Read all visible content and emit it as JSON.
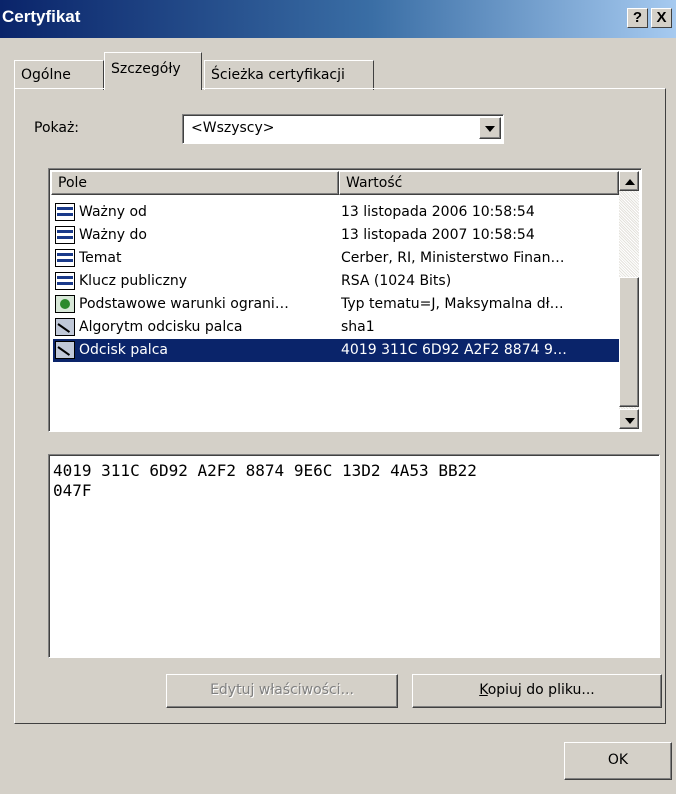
{
  "window": {
    "title": "Certyfikat",
    "help_label": "?",
    "close_label": "X"
  },
  "tabs": [
    {
      "label": "Ogólne",
      "active": false
    },
    {
      "label": "Szczegóły",
      "active": true
    },
    {
      "label": "Ścieżka certyfikacji",
      "active": false
    }
  ],
  "show": {
    "label": "Pokaż:",
    "selected": "<Wszyscy>"
  },
  "list": {
    "columns": [
      "Pole",
      "Wartość"
    ],
    "rows": [
      {
        "field": "Ważny od",
        "value": "13 listopada 2006 10:58:54",
        "icon": "certificate-field-icon"
      },
      {
        "field": "Ważny do",
        "value": "13 listopada 2007 10:58:54",
        "icon": "certificate-field-icon"
      },
      {
        "field": "Temat",
        "value": "Cerber, RI, Ministerstwo Finan…",
        "icon": "certificate-field-icon"
      },
      {
        "field": "Klucz publiczny",
        "value": "RSA (1024 Bits)",
        "icon": "certificate-field-icon"
      },
      {
        "field": "Podstawowe warunki ograni…",
        "value": "Typ tematu=J, Maksymalna dł…",
        "icon": "extension-icon"
      },
      {
        "field": "Algorytm odcisku palca",
        "value": "sha1",
        "icon": "algorithm-icon"
      },
      {
        "field": "Odcisk palca",
        "value": "4019 311C 6D92 A2F2 8874 9…",
        "icon": "algorithm-icon",
        "selected": true
      }
    ]
  },
  "detail": {
    "line1": "4019 311C 6D92 A2F2 8874 9E6C 13D2 4A53 BB22",
    "line2": "047F"
  },
  "buttons": {
    "edit_label": "Edytuj właściwości...",
    "copy_label_mnemonic": "K",
    "copy_label_rest": "opiuj do pliku...",
    "ok_label": "OK"
  }
}
